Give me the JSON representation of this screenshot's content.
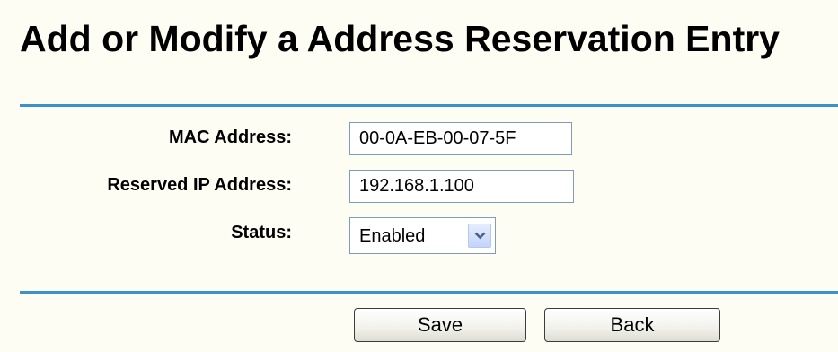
{
  "title": "Add or Modify a Address Reservation Entry",
  "form": {
    "mac_label": "MAC Address:",
    "mac_value": "00-0A-EB-00-07-5F",
    "ip_label": "Reserved IP Address:",
    "ip_value": "192.168.1.100",
    "status_label": "Status:",
    "status_value": "Enabled",
    "status_icon": "chevron-down-icon"
  },
  "buttons": {
    "save_label": "Save",
    "back_label": "Back"
  },
  "colors": {
    "background": "#fdfdf3",
    "divider": "#3b92c9"
  }
}
